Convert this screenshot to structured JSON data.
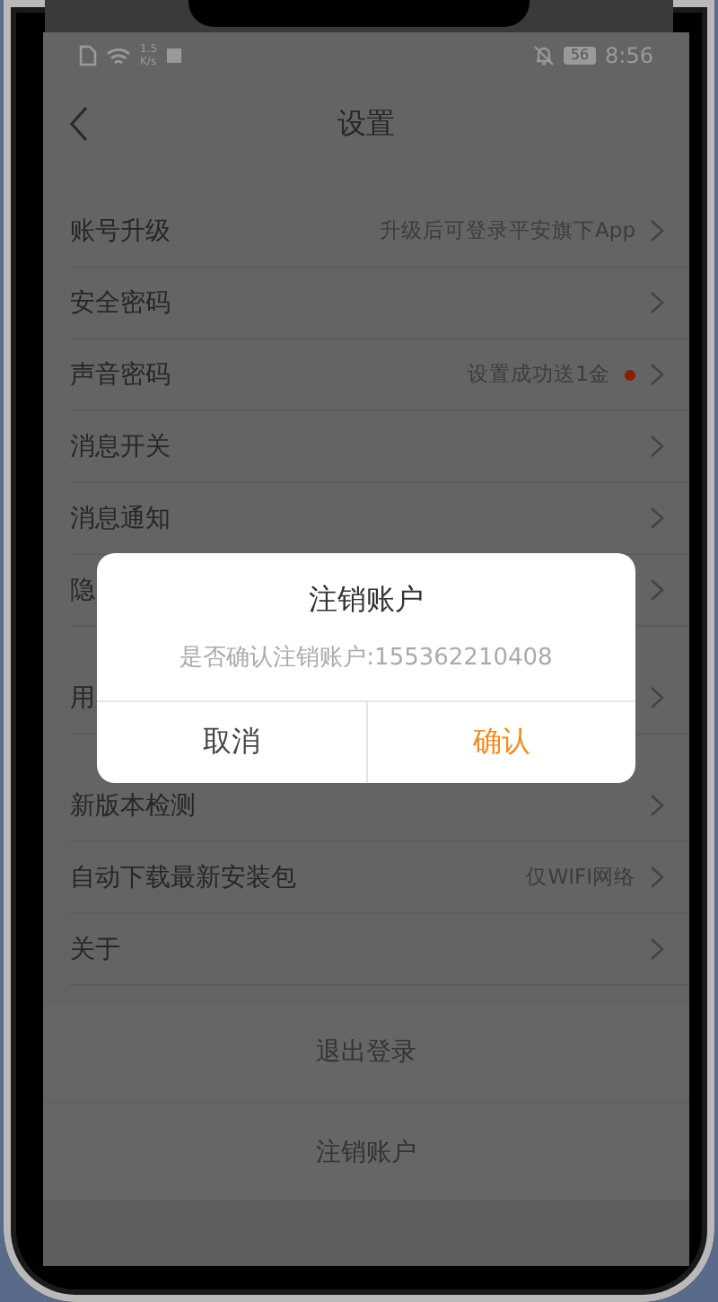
{
  "status_bar": {
    "speed_value": "1.5",
    "speed_unit": "K/s",
    "battery": "56",
    "time": "8:56"
  },
  "header": {
    "title": "设置"
  },
  "groups": [
    {
      "items": [
        {
          "label": "账号升级",
          "detail": "升级后可登录平安旗下App",
          "dot": false
        },
        {
          "label": "安全密码",
          "dot": false
        },
        {
          "label": "声音密码",
          "detail": "设置成功送1金",
          "dot": true
        },
        {
          "label": "消息开关",
          "dot": false
        },
        {
          "label": "消息通知",
          "dot": false
        },
        {
          "label": "隐",
          "dot": false
        }
      ]
    },
    {
      "items": [
        {
          "label": "用",
          "dot": false
        }
      ]
    },
    {
      "items": [
        {
          "label": "新版本检测",
          "dot": false
        },
        {
          "label": "自动下载最新安装包",
          "detail": "仅WIFI网络",
          "dot": false
        },
        {
          "label": "关于",
          "dot": false
        }
      ]
    }
  ],
  "actions": [
    {
      "label": "退出登录"
    },
    {
      "label": "注销账户"
    }
  ],
  "dialog": {
    "title": "注销账户",
    "message": "是否确认注销账户:155362210408",
    "buttons": [
      {
        "label": "取消",
        "kind": "cancel"
      },
      {
        "label": "确认",
        "kind": "confirm"
      }
    ]
  }
}
